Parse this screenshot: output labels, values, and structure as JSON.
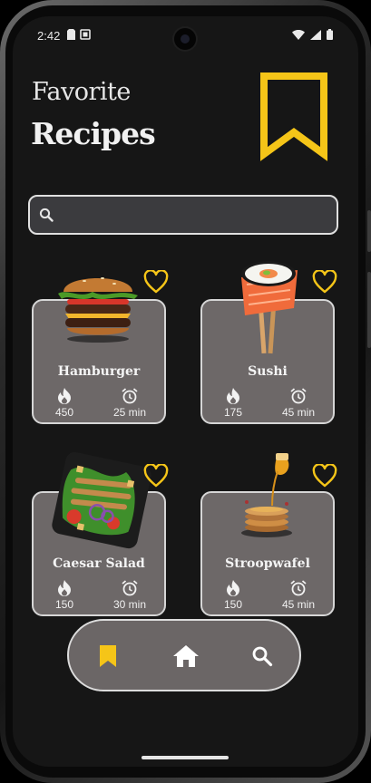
{
  "status_bar": {
    "time": "2:42",
    "icons": [
      "sim-card-icon",
      "screenshot-icon",
      "wifi-icon",
      "signal-icon",
      "battery-icon"
    ]
  },
  "header": {
    "title_line1": "Favorite",
    "title_line2": "Recipes",
    "bookmark_icon": "bookmark-outline-icon"
  },
  "search": {
    "placeholder": "",
    "value": "",
    "icon": "search-icon"
  },
  "recipes": [
    {
      "name": "Hamburger",
      "calories": "450",
      "time": "25 min",
      "favorite": "heart-outline-icon"
    },
    {
      "name": "Sushi",
      "calories": "175",
      "time": "45 min",
      "favorite": "heart-outline-icon"
    },
    {
      "name": "Caesar Salad",
      "calories": "150",
      "time": "30 min",
      "favorite": "heart-outline-icon"
    },
    {
      "name": "Stroopwafel",
      "calories": "150",
      "time": "45 min",
      "favorite": "heart-outline-icon"
    }
  ],
  "bottom_nav": {
    "items": [
      {
        "name": "favorites",
        "icon": "bookmark-icon",
        "active": true
      },
      {
        "name": "home",
        "icon": "home-icon",
        "active": false
      },
      {
        "name": "search",
        "icon": "search-icon",
        "active": false
      }
    ]
  },
  "colors": {
    "accent": "#F5C518",
    "background": "#161616",
    "card": "#6D6868",
    "search_bg": "#3B3B3E"
  }
}
